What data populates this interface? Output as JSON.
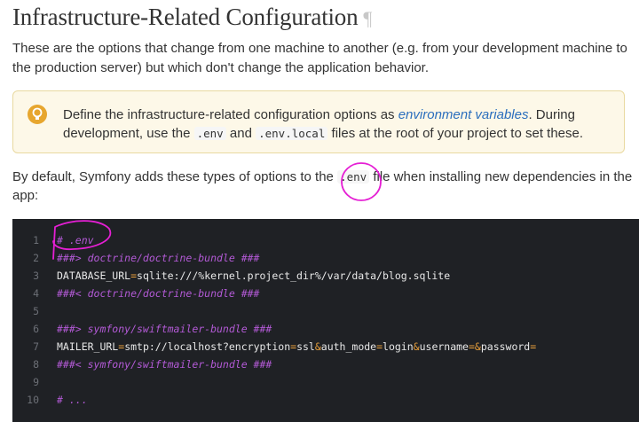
{
  "heading": {
    "title": "Infrastructure-Related Configuration",
    "anchor": "¶"
  },
  "intro": "These are the options that change from one machine to another (e.g. from your development machine to the production server) but which don't change the application behavior.",
  "tip": {
    "icon": "lightbulb-icon",
    "text_before": "Define the infrastructure-related configuration options as ",
    "link": "environment variables",
    "text_mid": ". During development, use the ",
    "code1": ".env",
    "and": " and ",
    "code2": ".env.local",
    "text_after": " files at the root of your project to set these."
  },
  "paragraph": {
    "before": "By default, Symfony adds these types of options to the ",
    "code": ".env",
    "after": " file when installing new dependencies in the app:"
  },
  "code": {
    "lines": [
      {
        "n": "1",
        "comment": "# .env"
      },
      {
        "n": "2",
        "comment": "###> doctrine/doctrine-bundle ###"
      },
      {
        "n": "3",
        "key": "DATABASE_URL",
        "op": "=",
        "val": "sqlite:///%kernel.project_dir%/var/data/blog.sqlite"
      },
      {
        "n": "4",
        "comment": "###< doctrine/doctrine-bundle ###"
      },
      {
        "n": "5"
      },
      {
        "n": "6",
        "comment": "###> symfony/swiftmailer-bundle ###"
      },
      {
        "n": "7",
        "key": "MAILER_URL",
        "op": "=",
        "val": "smtp://localhost?encryption",
        "op2": "=",
        "val2": "ssl",
        "op3": "&",
        "val3": "auth_mode",
        "op4": "=",
        "val4": "login",
        "op5": "&",
        "val5": "username",
        "op6": "=&",
        "val6": "password",
        "op7": "="
      },
      {
        "n": "8",
        "comment": "###< symfony/swiftmailer-bundle ###"
      },
      {
        "n": "9"
      },
      {
        "n": "10",
        "comment": "# ..."
      }
    ]
  },
  "colors": {
    "annotation": "#e51fd4",
    "comment": "#b35ad6",
    "operator": "#e9a03b",
    "link": "#2a6ebd",
    "tip_bg": "#fdf8e8",
    "code_bg": "#1f2125"
  }
}
